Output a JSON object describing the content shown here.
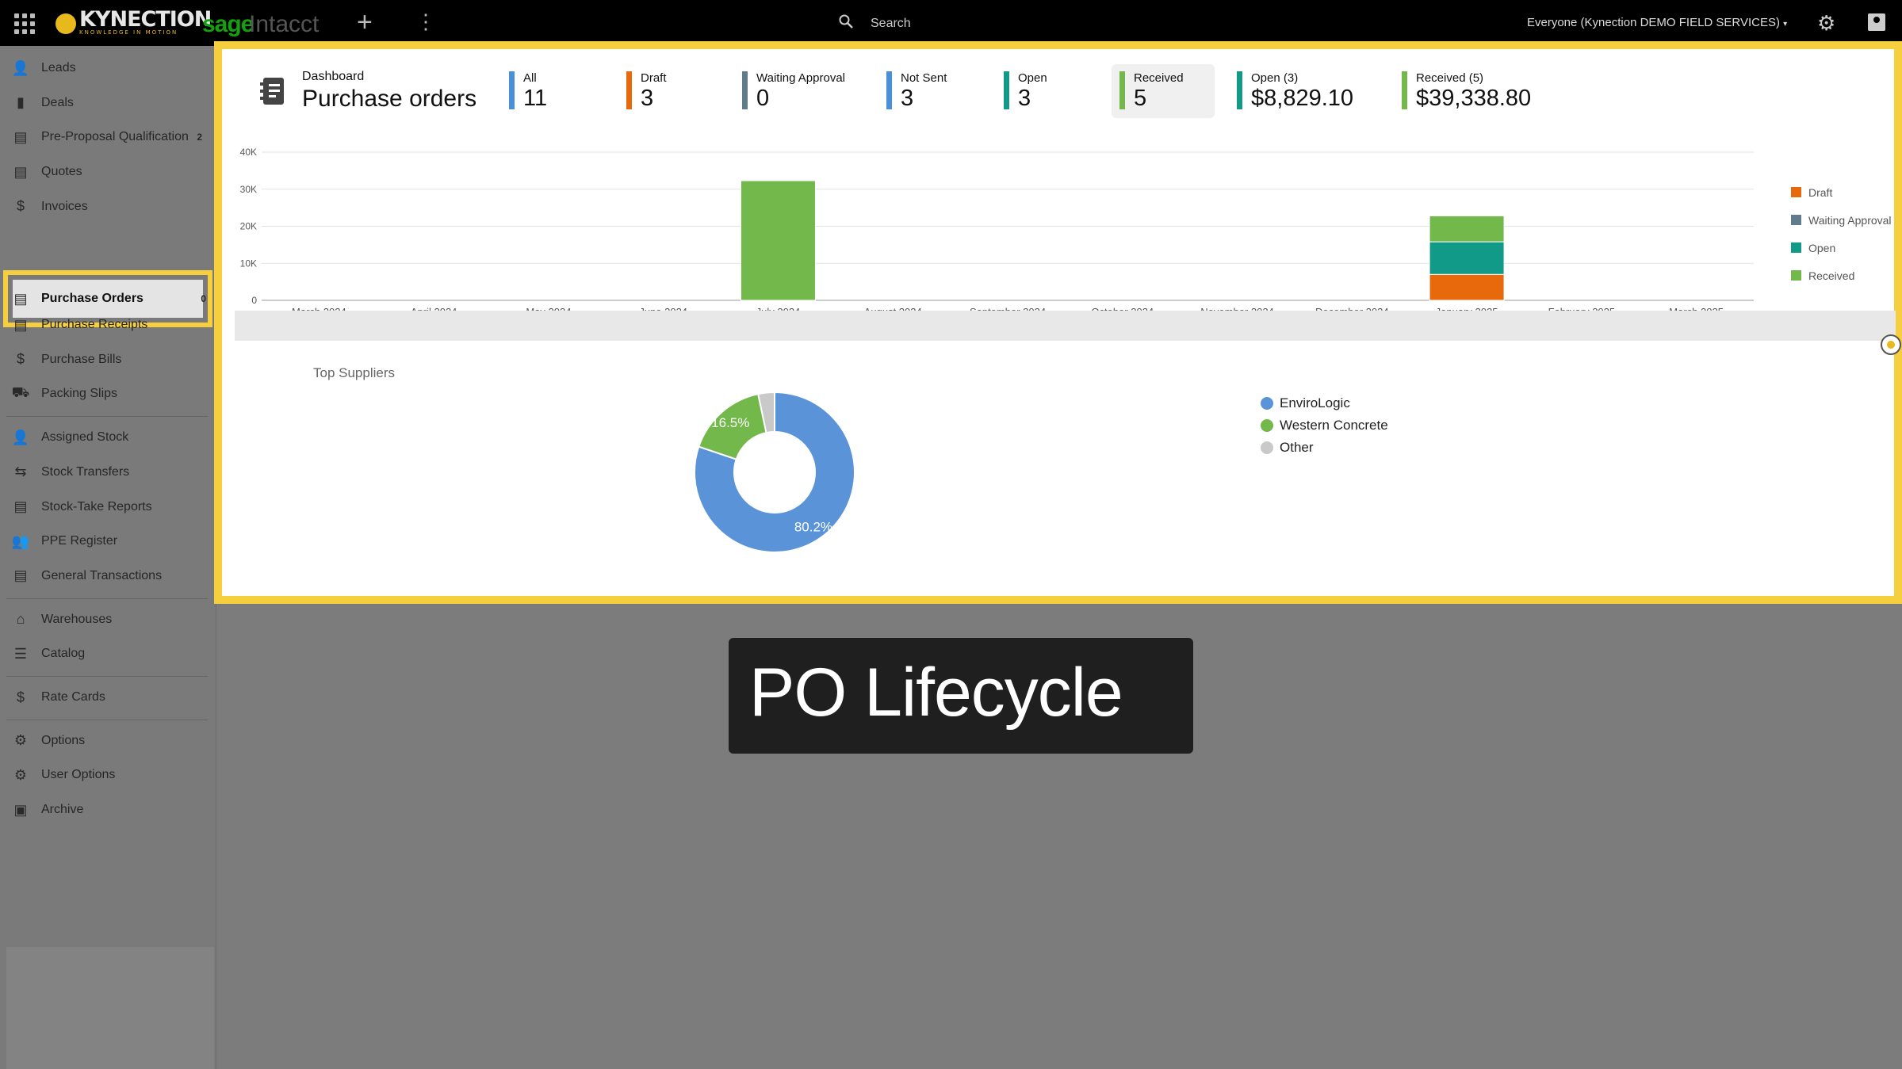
{
  "topbar": {
    "logo_text": "KYNECTION",
    "logo_tagline": "KNOWLEDGE IN MOTION",
    "partner_brand": "sage",
    "partner_product": "Intacct",
    "search_placeholder": "Search",
    "org_selector": "Everyone (Kynection DEMO FIELD SERVICES)",
    "org_selector_caret": "▾",
    "icons": [
      "apps-grid-icon",
      "add-icon",
      "more-vertical-icon",
      "search-icon",
      "settings-gear-icon",
      "account-icon"
    ]
  },
  "sidebar": {
    "groups": [
      [
        {
          "label": "Leads",
          "icon": "person-icon",
          "glyph": "👤"
        },
        {
          "label": "Deals",
          "icon": "bar-chart-icon",
          "glyph": "▮"
        },
        {
          "label": "Pre-Proposal Qualification",
          "icon": "clipboard-icon",
          "glyph": "▤",
          "count": "2"
        },
        {
          "label": "Quotes",
          "icon": "document-icon",
          "glyph": "▤"
        },
        {
          "label": "Invoices",
          "icon": "dollar-icon",
          "glyph": "$"
        },
        {
          "label": "Purchase Orders",
          "icon": "document-icon",
          "glyph": "▤",
          "count": "0",
          "active": true
        },
        {
          "label": "Purchase Receipts",
          "icon": "receipt-icon",
          "glyph": "▤"
        },
        {
          "label": "Purchase Bills",
          "icon": "dollar-icon",
          "glyph": "$"
        },
        {
          "label": "Packing Slips",
          "icon": "truck-icon",
          "glyph": "⛟"
        }
      ],
      [
        {
          "label": "Assigned Stock",
          "icon": "person-check-icon",
          "glyph": "👤"
        },
        {
          "label": "Stock Transfers",
          "icon": "transfer-icon",
          "glyph": "⇆"
        },
        {
          "label": "Stock-Take Reports",
          "icon": "report-icon",
          "glyph": "▤"
        },
        {
          "label": "PPE Register",
          "icon": "people-icon",
          "glyph": "👥"
        },
        {
          "label": "General Transactions",
          "icon": "clipboard-icon",
          "glyph": "▤"
        }
      ],
      [
        {
          "label": "Warehouses",
          "icon": "warehouse-icon",
          "glyph": "⌂"
        },
        {
          "label": "Catalog",
          "icon": "list-icon",
          "glyph": "☰"
        }
      ],
      [
        {
          "label": "Rate Cards",
          "icon": "dollar-icon",
          "glyph": "$"
        }
      ],
      [
        {
          "label": "Options",
          "icon": "gear-icon",
          "glyph": "⚙"
        },
        {
          "label": "User Options",
          "icon": "gear-icon",
          "glyph": "⚙"
        },
        {
          "label": "Archive",
          "icon": "archive-icon",
          "glyph": "▣"
        }
      ]
    ]
  },
  "dashboard": {
    "breadcrumb": "Dashboard",
    "title": "Purchase orders",
    "stats": [
      {
        "label": "All",
        "value": "11",
        "color": "#4a90d9"
      },
      {
        "label": "Draft",
        "value": "3",
        "color": "#e8690c"
      },
      {
        "label": "Waiting Approval",
        "value": "0",
        "color": "#607b8b"
      },
      {
        "label": "Not Sent",
        "value": "3",
        "color": "#4a90d9"
      },
      {
        "label": "Open",
        "value": "3",
        "color": "#119a88"
      },
      {
        "label": "Received",
        "value": "5",
        "color": "#73b84a",
        "selected": true
      },
      {
        "label": "Open (3)",
        "value": "$8,829.10",
        "color": "#119a88"
      },
      {
        "label": "Received (5)",
        "value": "$39,338.80",
        "color": "#73b84a"
      }
    ]
  },
  "chart_data": [
    {
      "type": "bar",
      "stacked": true,
      "categories": [
        "March 2024",
        "April 2024",
        "May 2024",
        "June 2024",
        "July 2024",
        "August 2024",
        "September 2024",
        "October 2024",
        "November 2024",
        "December 2024",
        "January 2025",
        "February 2025",
        "March 2025"
      ],
      "series": [
        {
          "name": "Draft",
          "color": "#e8690c",
          "values": [
            0,
            0,
            0,
            0,
            0,
            0,
            0,
            0,
            0,
            0,
            7000,
            0,
            0
          ]
        },
        {
          "name": "Waiting Approval",
          "color": "#607b8b",
          "values": [
            0,
            0,
            0,
            0,
            0,
            0,
            0,
            0,
            0,
            0,
            0,
            0,
            0
          ]
        },
        {
          "name": "Open",
          "color": "#119a88",
          "values": [
            0,
            0,
            0,
            0,
            0,
            0,
            0,
            0,
            0,
            0,
            8800,
            0,
            0
          ]
        },
        {
          "name": "Received",
          "color": "#73b84a",
          "values": [
            0,
            0,
            0,
            0,
            32300,
            0,
            0,
            0,
            0,
            0,
            7000,
            0,
            0
          ]
        }
      ],
      "y_ticks": [
        "0",
        "10K",
        "20K",
        "30K",
        "40K"
      ],
      "ylim": [
        0,
        40000
      ],
      "grid": true,
      "legend_position": "right"
    },
    {
      "type": "pie",
      "donut": true,
      "title": "Top Suppliers",
      "slices": [
        {
          "name": "EnviroLogic",
          "value": 80.2,
          "label": "80.2%",
          "color": "#5b93d8"
        },
        {
          "name": "Western Concrete",
          "value": 16.5,
          "label": "16.5%",
          "color": "#73b84a"
        },
        {
          "name": "Other",
          "value": 3.3,
          "label": "",
          "color": "#c9c9c9"
        }
      ],
      "legend_position": "right"
    }
  ],
  "caption": {
    "text": "PO Lifecycle"
  }
}
